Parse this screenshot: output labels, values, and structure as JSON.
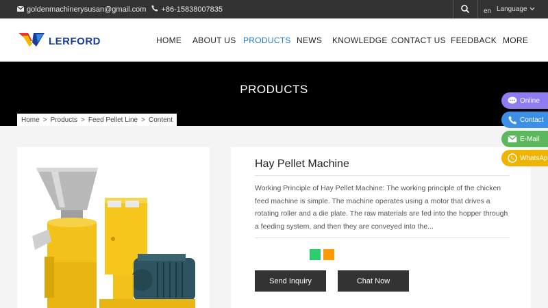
{
  "topbar": {
    "email": "goldenmachinerysusan@gmail.com",
    "phone": "+86-15838007835",
    "lang_code": "en",
    "language_label": "Language"
  },
  "logo": {
    "text": "LERFORD"
  },
  "nav": {
    "items": [
      {
        "label": "HOME",
        "active": false
      },
      {
        "label": "ABOUT US",
        "active": false
      },
      {
        "label": "PRODUCTS",
        "active": true
      },
      {
        "label": "NEWS",
        "active": false
      },
      {
        "label": "KNOWLEDGE",
        "active": false
      },
      {
        "label": "CONTACT US",
        "active": false
      },
      {
        "label": "FEEDBACK",
        "active": false
      },
      {
        "label": "MORE",
        "active": false
      }
    ]
  },
  "banner": {
    "title": "PRODUCTS"
  },
  "breadcrumb": {
    "items": [
      "Home",
      "Products",
      "Feed Pellet Line",
      "Content"
    ],
    "separator": ">"
  },
  "product": {
    "title": "Hay Pellet Machine",
    "description": "Working Principle of Hay Pellet Machine: The working principle of the chicken feed machine is simple. The machine operates using a motor that drives a rotating roller and a die plate. The raw materials are fed into the hopper through a feeding system, and then they are conveyed into the...",
    "share_colors": [
      "#2ecc71",
      "#ff9900"
    ],
    "send_inquiry_label": "Send Inquiry",
    "chat_now_label": "Chat Now"
  },
  "floating": {
    "online": {
      "label": "Online",
      "color": "#8e7cf0"
    },
    "contact": {
      "label": "Contact",
      "color": "#3b8fe6"
    },
    "email": {
      "label": "E-Mail",
      "color": "#5cb85c"
    },
    "whatsapp": {
      "label": "WhatsApp",
      "color": "#f0b400"
    }
  },
  "colors": {
    "accent": "#1f7cc4",
    "topbar": "#333333",
    "banner": "#000000"
  }
}
